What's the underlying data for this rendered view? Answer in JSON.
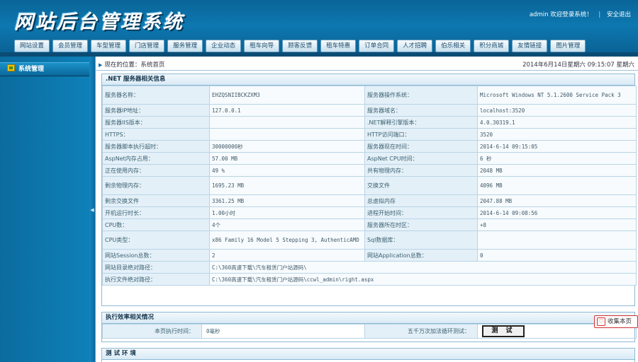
{
  "header": {
    "logo_text": "网站后台管理系统",
    "user": "admin",
    "welcome": "欢迎登录系统！",
    "separator": "|",
    "logout": "安全退出"
  },
  "nav": {
    "items": [
      "网站设置",
      "会员管理",
      "车型管理",
      "门店管理",
      "服务管理",
      "企业动态",
      "租车向导",
      "顾客反馈",
      "租车特惠",
      "订单合同",
      "人才招聘",
      "伯乐相关",
      "积分商城",
      "友情链接",
      "图片管理"
    ]
  },
  "sidebar": {
    "title": "系统管理"
  },
  "breadcrumb": {
    "text": "现在的位置：系统首页"
  },
  "datetime": "2014年6月14日星期六 09:15:07 星期六",
  "server_panel": {
    "title": ".NET 服务器相关信息",
    "rows": [
      {
        "l1": "服务器名称：",
        "v1": "EHZQSNIIBCKZXM3",
        "l2": "服务器操作系统：",
        "v2": "Microsoft Windows NT 5.1.2600 Service Pack 3"
      },
      {
        "l1": "服务器IP地址：",
        "v1": "127.0.0.1",
        "l2": "服务器域名：",
        "v2": "localhost:3520"
      },
      {
        "l1": "服务器IIS版本：",
        "v1": "",
        "l2": ".NET解释引擎版本：",
        "v2": "4.0.30319.1"
      },
      {
        "l1": "HTTPS：",
        "v1": "",
        "l2": "HTTP访问端口：",
        "v2": "3520"
      },
      {
        "l1": "服务器脚本执行超时：",
        "v1": "30000000秒",
        "l2": "服务器现在时间：",
        "v2": "2014-6-14 09:15:05"
      },
      {
        "l1": "AspNet内存占用：",
        "v1": "57.00 MB",
        "l2": "AspNet CPU时间：",
        "v2": "6 秒"
      },
      {
        "l1": "正在使用内存：",
        "v1": "49 %",
        "l2": "共有物理内存：",
        "v2": "2048 MB"
      },
      {
        "l1": "剩余物理内存：",
        "v1": "1695.23 MB",
        "l2": "交换文件",
        "v2": "4096 MB"
      },
      {
        "l1": "剩余交换文件",
        "v1": "3361.25 MB",
        "l2": "总虚拟内存",
        "v2": "2047.88 MB"
      },
      {
        "l1": "开机运行时长：",
        "v1": "1.00小时",
        "l2": "进程开始时间：",
        "v2": "2014-6-14 09:08:56"
      },
      {
        "l1": "CPU数：",
        "v1": "4个",
        "l2": "服务器所在时区：",
        "v2": "+8"
      },
      {
        "l1": "CPU类型：",
        "v1": "x86 Family 16 Model 5 Stepping 3, AuthenticAMD",
        "l2": "Sql数据库：",
        "v2": ""
      },
      {
        "l1": "网站Session总数：",
        "v1": "2",
        "l2": "网站Application总数：",
        "v2": "0"
      }
    ],
    "wide_rows": [
      {
        "label": "网站目录绝对路径：",
        "value": "C:\\360高速下载\\汽车租赁门户站源码\\"
      },
      {
        "label": "执行文件绝对路径：",
        "value": "C:\\360高速下载\\汽车租赁门户站源码\\ccwl_admin\\right.aspx"
      }
    ]
  },
  "efficiency_panel": {
    "title": "执行效率相关情况",
    "time_label": "本页执行时间：",
    "time_value": "0毫秒",
    "loop_label": "五千万次加法循环测试：",
    "test_button": "测 试"
  },
  "env_panel": {
    "title": "测 试 环 境"
  },
  "favorite": {
    "icon_glyph": "♡",
    "label": "收集本页"
  }
}
